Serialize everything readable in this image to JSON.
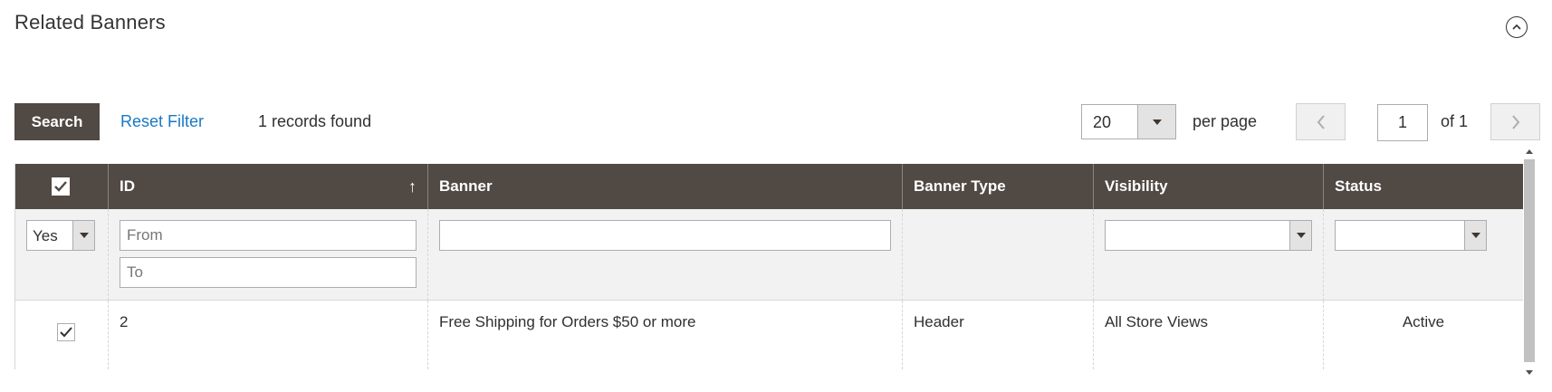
{
  "section": {
    "title": "Related Banners"
  },
  "toolbar": {
    "search_label": "Search",
    "reset_label": "Reset Filter",
    "records_text": "1 records found",
    "per_page_value": "20",
    "per_page_label": "per page",
    "current_page": "1",
    "of_pages": "of 1"
  },
  "grid": {
    "columns": [
      "ID",
      "Banner",
      "Banner Type",
      "Visibility",
      "Status"
    ],
    "sort_indicator": "↑",
    "filters": {
      "select_value": "Yes",
      "id_from_placeholder": "From",
      "id_to_placeholder": "To",
      "banner_value": "",
      "visibility_value": "",
      "status_value": ""
    },
    "rows": [
      {
        "checked": true,
        "id": "2",
        "banner": "Free Shipping for Orders $50 or more",
        "type": "Header",
        "visibility": "All Store Views",
        "status": "Active"
      }
    ]
  },
  "colors": {
    "header_bg": "#514943",
    "link": "#1979c3",
    "filter_bg": "#f2f2f2"
  }
}
